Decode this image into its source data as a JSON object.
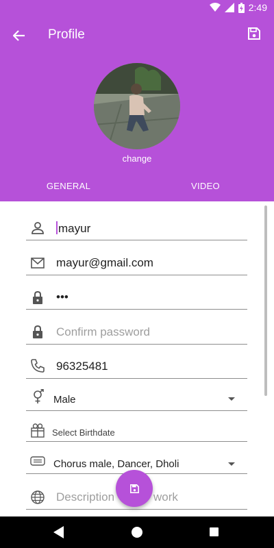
{
  "status_bar": {
    "time": "2:49",
    "icons": [
      "wifi-icon",
      "signal-icon",
      "battery-charging-icon"
    ]
  },
  "header": {
    "title": "Profile",
    "back_icon": "arrow-left-icon",
    "save_icon": "save-icon"
  },
  "profile": {
    "change_label": "change"
  },
  "tabs": [
    {
      "label": "GENERAL"
    },
    {
      "label": "VIDEO"
    }
  ],
  "form": {
    "name": {
      "value": "mayur",
      "icon": "person-icon"
    },
    "email": {
      "value": "mayur@gmail.com",
      "icon": "mail-icon"
    },
    "password": {
      "value": "•••",
      "icon": "lock-icon"
    },
    "confirm_password": {
      "placeholder": "Confirm password",
      "icon": "lock-icon"
    },
    "phone": {
      "value": "96325481",
      "icon": "phone-icon"
    },
    "gender": {
      "selected": "Male",
      "icon": "gender-icon"
    },
    "birthdate": {
      "placeholder": "Select Birthdate",
      "icon": "gift-icon"
    },
    "talents": {
      "selected": "Chorus male, Dancer, Dholi",
      "icon": "keyboard-icon"
    },
    "description": {
      "placeholder_left": "Description",
      "placeholder_right": "work",
      "icon": "globe-icon"
    }
  },
  "fab": {
    "icon": "save-icon"
  },
  "colors": {
    "accent": "#b651d9",
    "nav_bar": "#000000"
  }
}
